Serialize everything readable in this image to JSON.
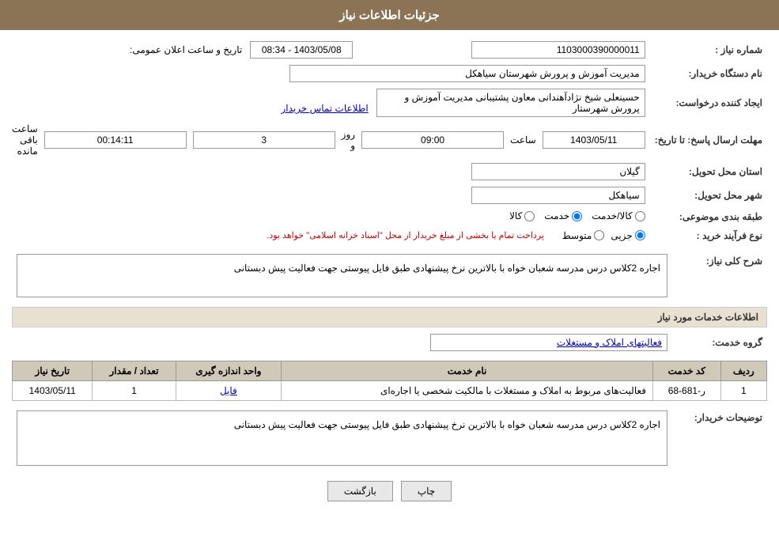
{
  "header": {
    "title": "جزئیات اطلاعات نیاز"
  },
  "fields": {
    "shomara_niaz_label": "شماره نیاز :",
    "shomara_niaz_value": "1103000390000011",
    "nam_dastgah_label": "نام دستگاه خریدار:",
    "nam_dastgah_value": "مدیریت آموزش و پرورش شهرستان سیاهکل",
    "ijad_konande_label": "ایجاد کننده درخواست:",
    "ijad_konande_value": "حسینعلی شیخ نژادآهندانی معاون پشتیبانی مدیریت آموزش و پرورش شهرستار",
    "ejad_link": "اطلاعات تماس خریدار",
    "mohlat_label": "مهلت ارسال پاسخ: تا تاریخ:",
    "mohlat_date": "1403/05/11",
    "mohlat_saat_label": "ساعت",
    "mohlat_saat_value": "09:00",
    "mohlat_rooz_label": "روز و",
    "mohlat_rooz_value": "3",
    "mohlat_baqi_label": "ساعت باقی مانده",
    "mohlat_baqi_value": "00:14:11",
    "ostan_label": "استان محل تحویل:",
    "ostan_value": "گیلان",
    "shahr_label": "شهر محل تحویل:",
    "shahr_value": "سیاهکل",
    "tabaqe_label": "طبقه بندی موضوعی:",
    "radio_kala": "کالا",
    "radio_khadamat": "خدمت",
    "radio_kala_khadamat": "کالا/خدمت",
    "radio_kala_selected": false,
    "radio_khadamat_selected": true,
    "radio_kala_khadamat_selected": false,
    "nooe_farayand_label": "نوع فرآیند خرید :",
    "radio_jozi": "جزیی",
    "radio_motavasset": "متوسط",
    "farayand_note": "پرداخت تمام یا بخشی از مبلغ خریدار از محل \"اسناد خزانه اسلامی\" خواهد بود.",
    "sharh_koli_label": "شرح کلی نیاز:",
    "sharh_koli_value": "اجاره 2کلاس درس مدرسه شعبان خواه با بالاترین نرخ پیشنهادی طبق فایل پیوستی جهت فعالیت پیش دبستانی",
    "etelaat_khadamat_header": "اطلاعات خدمات مورد نیاز",
    "gorooh_khadamat_label": "گروه خدمت:",
    "gorooh_khadamat_value": "فعالیتهای  املاک  و مستغلات",
    "table": {
      "headers": [
        "ردیف",
        "کد خدمت",
        "نام خدمت",
        "واحد اندازه گیری",
        "تعداد / مقدار",
        "تاریخ نیاز"
      ],
      "rows": [
        {
          "radif": "1",
          "kod_khadamat": "ر-681-68",
          "nam_khadamat": "فعالیت‌های مربوط به املاک و مستغلات با مالکیت شخصی یا اجاره‌ای",
          "vahed": "فایل",
          "tedad": "1",
          "tarikh": "1403/05/11"
        }
      ]
    },
    "tosifat_label": "توضیحات خریدار:",
    "tosifat_value": "اجاره 2کلاس درس مدرسه شعبان خواه با بالاترین نرخ پیشنهادی طبق فایل پیوستی جهت فعالیت پیش دبستانی"
  },
  "buttons": {
    "chap": "چاپ",
    "bazgasht": "بازگشت"
  }
}
